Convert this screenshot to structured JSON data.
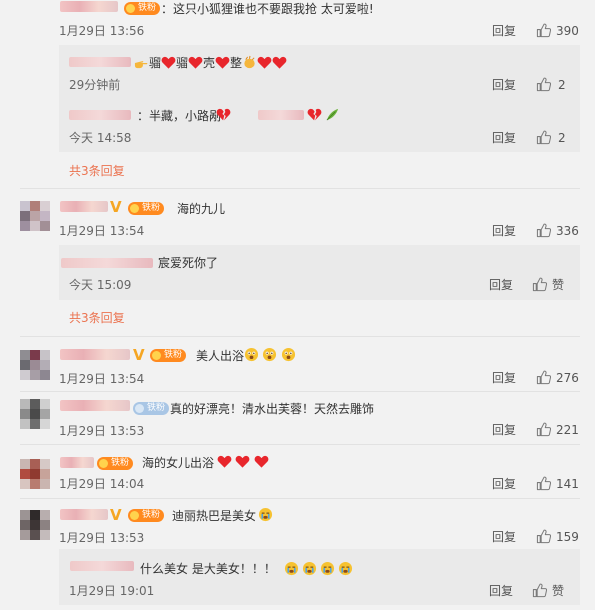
{
  "comments": [
    {
      "text": "：这只小狐狸谁也不要跟我抢 太可爱啦!",
      "time": "1月29日 13:56",
      "reply": "回复",
      "likes": "390",
      "fan_badge": "铁粉",
      "replies": [
        {
          "text_parts": [
            "骝",
            "骝",
            "壳",
            "整"
          ],
          "time": "29分钟前",
          "reply": "回复",
          "likes": "2"
        },
        {
          "text": "：半藏，小路剐",
          "time": "今天 14:58",
          "reply": "回复",
          "likes": "2"
        }
      ],
      "more": "共3条回复"
    },
    {
      "text": "海的九儿",
      "time": "1月29日 13:54",
      "reply": "回复",
      "likes": "336",
      "fan_badge": "铁粉",
      "replies": [
        {
          "text": "宸爱死你了",
          "time": "今天 15:09",
          "reply": "回复",
          "likes": "赞"
        }
      ],
      "more": "共3条回复"
    },
    {
      "text": "美人出浴",
      "time": "1月29日 13:54",
      "reply": "回复",
      "likes": "276",
      "fan_badge": "铁粉"
    },
    {
      "text": "真的好漂亮！清水出芙蓉！天然去雕饰",
      "time": "1月29日 13:53",
      "reply": "回复",
      "likes": "221",
      "fan_badge": "铁粉"
    },
    {
      "text": "海的女儿出浴",
      "time": "1月29日 14:04",
      "reply": "回复",
      "likes": "141",
      "fan_badge": "铁粉"
    },
    {
      "text": "迪丽热巴是美女",
      "time": "1月29日 13:53",
      "reply": "回复",
      "likes": "159",
      "fan_badge": "铁粉",
      "replies": [
        {
          "text": "什么美女 是大美女！！！",
          "time": "1月29日 19:01",
          "reply": "回复",
          "likes": "赞"
        }
      ]
    }
  ],
  "icons": {
    "like": "thumbs-up-icon",
    "vip": "v-badge-icon",
    "heart": "heart-icon",
    "broken_heart": "broken-heart-icon",
    "clap": "clapping-hands-icon",
    "point": "pointing-hand-icon",
    "leaf": "leaf-icon",
    "surprise": "surprised-face-icon",
    "cry": "crying-face-icon"
  },
  "colors": {
    "accent": "#eb7350",
    "background": "#f2f2f2",
    "reply_background": "#eaeaea",
    "heart": "#e8262c",
    "fan_badge": "#ff8a1f",
    "vip": "#f5a623"
  }
}
